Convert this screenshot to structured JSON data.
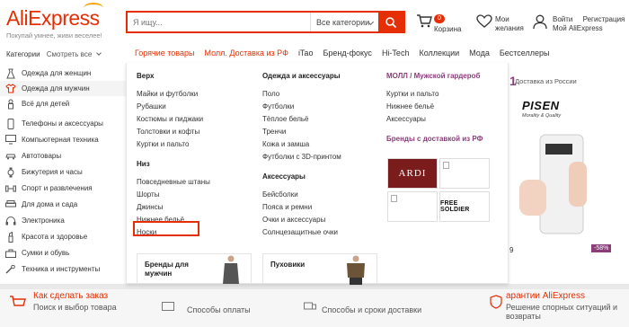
{
  "header": {
    "logo": "AliExpress",
    "tagline": "Покупай умнее, живи веселее!",
    "search_placeholder": "Я ищу...",
    "search_category": "Все категории",
    "cart_count": "0",
    "cart_label": "Корзина",
    "wishlist_label_1": "Мои",
    "wishlist_label_2": "желания",
    "login": "Войти",
    "register": "Регистрация",
    "my_account": "Мой AliExpress"
  },
  "navbar": {
    "categories": "Категории",
    "see_all": "Смотреть все",
    "items": [
      "Горячие товары",
      "Молл. Доставка из РФ",
      "iTao",
      "Бренд-фокус",
      "Hi-Tech",
      "Коллекции",
      "Мода",
      "Бестселлеры"
    ]
  },
  "sidebar": {
    "items": [
      "Одежда для женщин",
      "Одежда для мужчин",
      "Всё для детей",
      "Телефоны и аксессуары",
      "Компьютерная техника",
      "Автотовары",
      "Бижутерия и часы",
      "Спорт и развлечения",
      "Для дома и сада",
      "Электроника",
      "Красота и здоровье",
      "Сумки и обувь",
      "Техника и инструменты"
    ]
  },
  "mega": {
    "col1": {
      "title_top": "Верх",
      "top_links": [
        "Майки и футболки",
        "Рубашки",
        "Костюмы и пиджаки",
        "Толстовки и кофты",
        "Куртки и пальто"
      ],
      "title_bottom": "Низ",
      "bottom_links": [
        "Повседневные штаны",
        "Шорты",
        "Джинсы",
        "Нижнее бельё",
        "Носки"
      ]
    },
    "col2": {
      "title_top": "Одежда и аксессуары",
      "top_links": [
        "Поло",
        "Футболки",
        "Тёплое бельё",
        "Тренчи",
        "Кожа и замша",
        "Футболки с 3D-принтом"
      ],
      "title_bottom": "Аксессуары",
      "bottom_links": [
        "Бейсболки",
        "Пояса и ремни",
        "Очки и аксессуары",
        "Солнцезащитные очки"
      ]
    },
    "col3": {
      "title_top": "МОЛЛ / Мужской гардероб",
      "top_links": [
        "Куртки и пальто",
        "Нижнее бельё",
        "Аксессуары"
      ],
      "title_brands": "Бренды с доставкой из РФ",
      "brand_ardi": "ARDI",
      "brand_fs": "FREE SOLDIER"
    },
    "promo1": "Бренды для мужчин",
    "promo1_a": "Бренды для",
    "promo1_b": "мужчин",
    "promo2": "Пуховики"
  },
  "right_panel": {
    "delivery": "Доставка из России",
    "brand": "PISEN",
    "brand_sub": "Morality & Quality",
    "discount": "-58%",
    "price_fragment": "9",
    "left_fragment": "1"
  },
  "footer": {
    "col1_title": "Как сделать заказ",
    "col1_sub": "Поиск и выбор товара",
    "col2_sub": "Способы оплаты",
    "col3_sub": "Способы и сроки доставки",
    "col4_title": "арантии AliExpress",
    "col4_sub1": "Решение спорных ситуаций и",
    "col4_sub2": "возвраты"
  },
  "colors": {
    "accent": "#e62e04",
    "purple": "#8b3d7a"
  }
}
